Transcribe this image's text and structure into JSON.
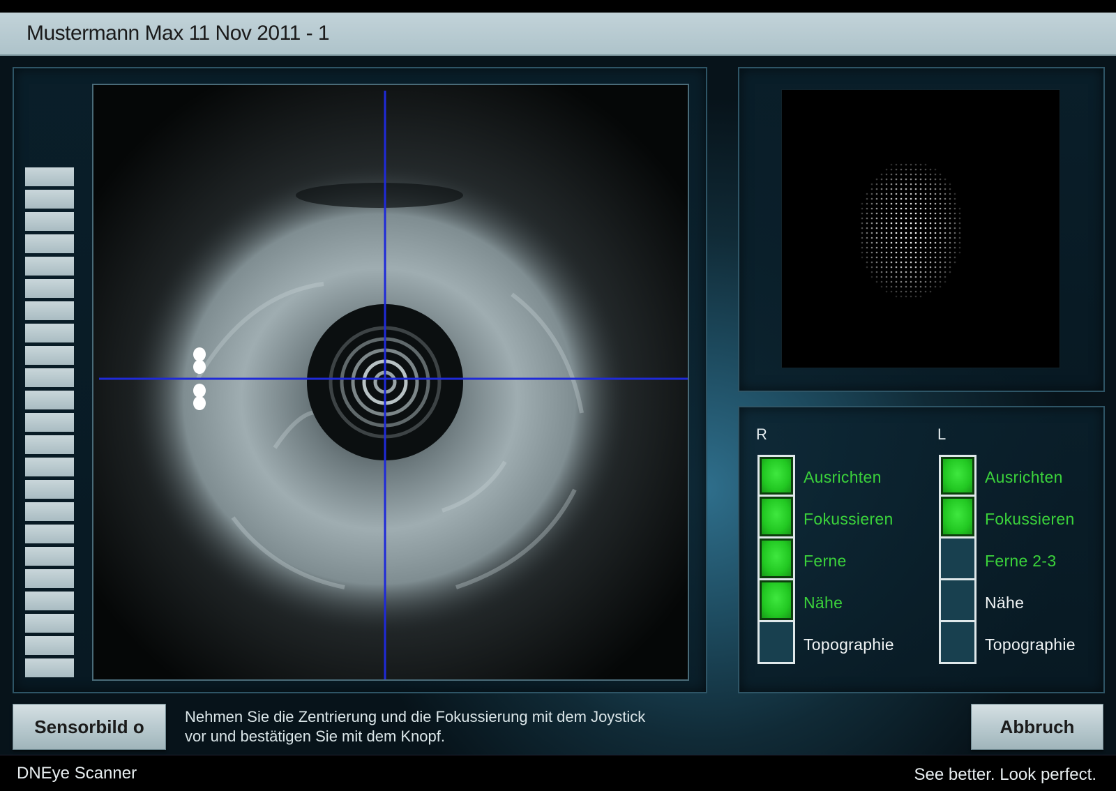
{
  "window": {
    "title": "Mustermann Max 11 Nov 2011 - 1"
  },
  "level_meter": {
    "segments": 23
  },
  "camera_view": {
    "crosshair_color": "#1f2ad8"
  },
  "eyes": {
    "right": {
      "letter": "R",
      "steps": [
        {
          "label": "Ausrichten",
          "done": true,
          "highlight": true
        },
        {
          "label": "Fokussieren",
          "done": true,
          "highlight": true
        },
        {
          "label": "Ferne",
          "done": true,
          "highlight": true
        },
        {
          "label": "Nähe",
          "done": true,
          "highlight": true
        },
        {
          "label": "Topographie",
          "done": false,
          "highlight": false
        }
      ]
    },
    "left": {
      "letter": "L",
      "steps": [
        {
          "label": "Ausrichten",
          "done": true,
          "highlight": true
        },
        {
          "label": "Fokussieren",
          "done": true,
          "highlight": true
        },
        {
          "label": "Ferne 2-3",
          "done": false,
          "highlight": true
        },
        {
          "label": "Nähe",
          "done": false,
          "highlight": false
        },
        {
          "label": "Topographie",
          "done": false,
          "highlight": false
        }
      ]
    }
  },
  "colors": {
    "active_green": "#3bd33b",
    "title_bar": "#b8cad0"
  },
  "buttons": {
    "sensor_label": "Sensorbild o",
    "abort_label": "Abbruch"
  },
  "instruction": {
    "line1": "Nehmen Sie die Zentrierung und die Fokussierung mit dem Joystick",
    "line2": "vor und bestätigen Sie mit dem Knopf."
  },
  "footer": {
    "app_name": "DNEye Scanner",
    "slogan": "See better. Look perfect."
  }
}
